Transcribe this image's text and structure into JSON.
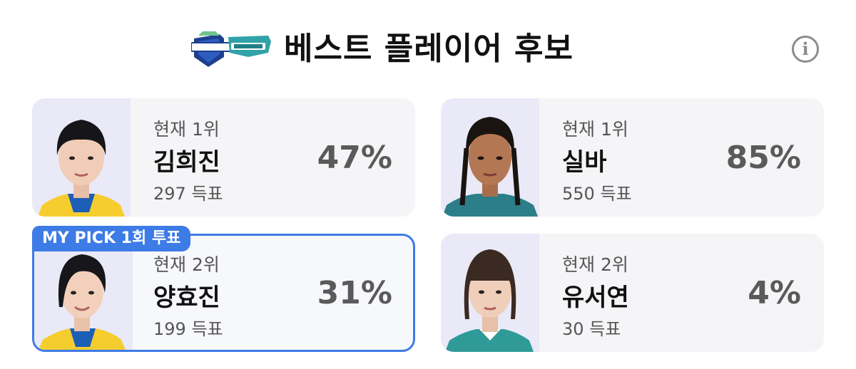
{
  "header": {
    "title": "베스트 플레이어 후보",
    "info_icon": "info-icon",
    "info_glyph": "i",
    "logo": "v-league-logo"
  },
  "colors": {
    "accent": "#3d7be6",
    "card_bg": "#f5f5f8",
    "photo_bg": "#e9e9f7",
    "percent": "#5a5a5a"
  },
  "players": {
    "p1": {
      "rank": "현재 1위",
      "name": "김희진",
      "votes": "297 득표",
      "percent": "47%"
    },
    "p2": {
      "rank": "현재 1위",
      "name": "실바",
      "votes": "550 득표",
      "percent": "85%"
    },
    "p3": {
      "rank": "현재 2위",
      "name": "양효진",
      "votes": "199 득표",
      "percent": "31%",
      "badge": "MY PICK 1회 투표"
    },
    "p4": {
      "rank": "현재 2위",
      "name": "유서연",
      "votes": "30 득표",
      "percent": "4%"
    }
  }
}
